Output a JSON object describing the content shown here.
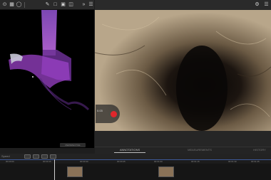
{
  "toolbar_left": {
    "icons": [
      "target-icon",
      "grid-icon",
      "circle-icon",
      "pen-icon",
      "annotate-icon",
      "save-icon",
      "map-icon",
      "forward-icon",
      "list-icon"
    ]
  },
  "viewer3d": {
    "view_label": "PERSPECTIVE"
  },
  "photo": {
    "pill_label": "0.03"
  },
  "tabs": {
    "primary": "ANNOTATIONS",
    "secondary": "MEASUREMENTS",
    "tertiary": "HISTORY"
  },
  "timeline": {
    "speed_label": "Speed",
    "ticks": [
      "00:00:00",
      "00:00:15",
      "00:00:30",
      "00:00:45",
      "00:01:00",
      "00:01:15",
      "00:01:30",
      "00:01:45"
    ]
  },
  "colors": {
    "accent": "#3e5a9a",
    "marker": "#e0262b",
    "model": "#b04dd8"
  }
}
